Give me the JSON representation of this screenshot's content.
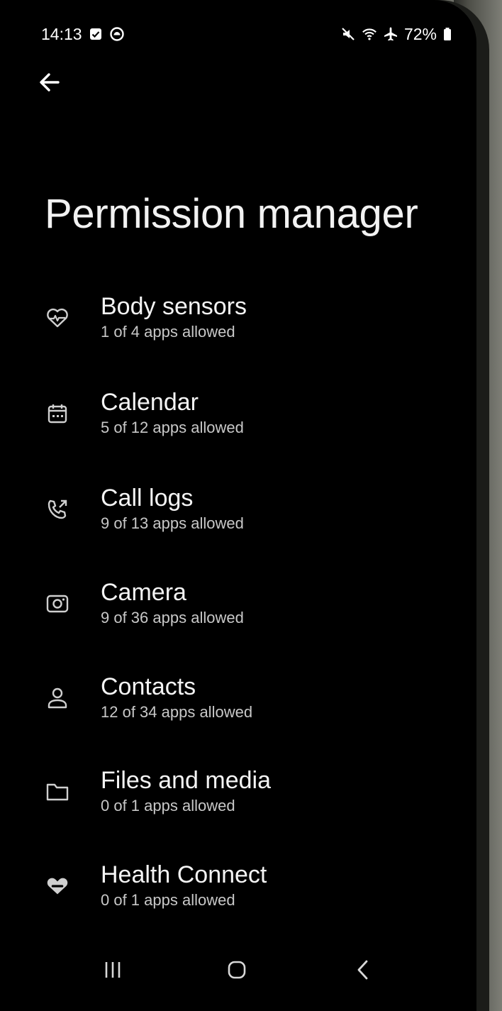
{
  "status_bar": {
    "time": "14:13",
    "left_icons": [
      "checkbox-notification-icon",
      "app-notification-icon"
    ],
    "right_icons": [
      "mute-icon",
      "wifi-icon",
      "airplane-mode-icon"
    ],
    "battery": "72%"
  },
  "header": {
    "back_icon": "back-arrow-icon",
    "title": "Permission manager"
  },
  "permissions": [
    {
      "name": "Body sensors",
      "count": "1 of 4 apps allowed",
      "icon": "heart-pulse-icon"
    },
    {
      "name": "Calendar",
      "count": "5 of 12 apps allowed",
      "icon": "calendar-icon"
    },
    {
      "name": "Call logs",
      "count": "9 of 13 apps allowed",
      "icon": "call-log-icon"
    },
    {
      "name": "Camera",
      "count": "9 of 36 apps allowed",
      "icon": "camera-icon"
    },
    {
      "name": "Contacts",
      "count": "12 of 34 apps allowed",
      "icon": "person-icon"
    },
    {
      "name": "Files and media",
      "count": "0 of 1 apps allowed",
      "icon": "folder-icon"
    },
    {
      "name": "Health Connect",
      "count": "0 of 1 apps allowed",
      "icon": "health-connect-icon"
    }
  ],
  "nav_bar": {
    "icons": [
      "recent-apps-icon",
      "home-icon",
      "back-icon"
    ]
  }
}
